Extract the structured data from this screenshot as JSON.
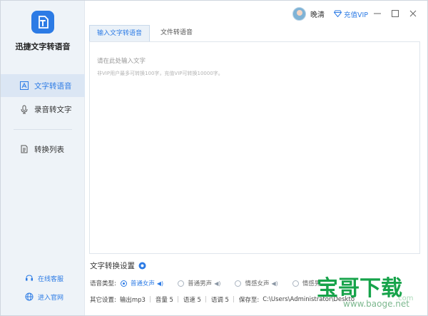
{
  "app": {
    "title": "迅捷文字转语音",
    "logo_icon": "document-logo-icon",
    "accent": "#2c7be5"
  },
  "sidebar": {
    "items": [
      {
        "label": "文字转语音",
        "icon": "text-icon",
        "active": true
      },
      {
        "label": "录音转文字",
        "icon": "microphone-icon",
        "active": false
      },
      {
        "label": "转换列表",
        "icon": "list-icon",
        "active": false
      }
    ],
    "bottom": [
      {
        "label": "在线客服",
        "icon": "headset-icon"
      },
      {
        "label": "进入官网",
        "icon": "globe-icon"
      }
    ]
  },
  "topbar": {
    "username": "晚清",
    "vip_label": "充值VIP",
    "window_controls": [
      "minimize-icon",
      "maximize-icon",
      "close-icon"
    ]
  },
  "tabs": [
    {
      "label": "输入文字转语音",
      "active": true
    },
    {
      "label": "文件转语音",
      "active": false
    }
  ],
  "editor": {
    "placeholder": "请在此处输入文字",
    "hint": "非VIP用户最多可转换100字，充值VIP可转换10000字。"
  },
  "settings": {
    "title": "文字转换设置",
    "voice_label": "语音类型:",
    "voices": [
      {
        "label": "普通女声",
        "selected": true
      },
      {
        "label": "普通男声",
        "selected": false
      },
      {
        "label": "情感女声",
        "selected": false
      },
      {
        "label": "情感男",
        "selected": false
      }
    ],
    "other_label": "其它设置:",
    "other": [
      "输出mp3",
      "音量 5",
      "语速 5",
      "语调 5"
    ],
    "save_label": "保存至:",
    "save_path": "C:\\Users\\Administrator\\Deskto"
  },
  "watermark": {
    "main": "宝哥下载",
    "sub": "www.baoge.net",
    "com": ".com"
  }
}
